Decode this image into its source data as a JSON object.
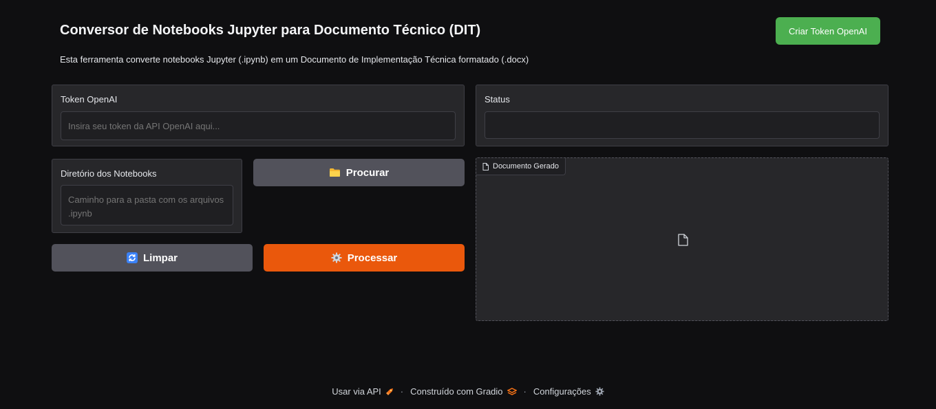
{
  "header": {
    "title": "Conversor de Notebooks Jupyter para Documento Técnico (DIT)",
    "subtitle": "Esta ferramenta converte notebooks Jupyter (.ipynb) em um Documento de Implementação Técnica formatado (.docx)",
    "token_button": "Criar Token OpenAI"
  },
  "token": {
    "label": "Token OpenAI",
    "placeholder": "Insira seu token da API OpenAI aqui...",
    "value": ""
  },
  "directory": {
    "label": "Diretório dos Notebooks",
    "placeholder": "Caminho para a pasta com os arquivos .ipynb",
    "value": ""
  },
  "buttons": {
    "browse": "Procurar",
    "clear": "Limpar",
    "process": "Processar"
  },
  "status": {
    "label": "Status",
    "value": ""
  },
  "document": {
    "label": "Documento Gerado"
  },
  "footer": {
    "api": "Usar via API",
    "built": "Construído com Gradio",
    "settings": "Configurações",
    "separator": "·"
  },
  "colors": {
    "accent_orange": "#ea580c",
    "token_green": "#4caf50",
    "button_gray": "#52525b",
    "background": "#0f0f11"
  },
  "icons": {
    "browse": "folder-icon",
    "clear": "refresh-icon",
    "process": "gear-icon",
    "document": "file-icon",
    "api": "rocket-icon",
    "gradio": "gradio-logo-icon",
    "settings": "gear-icon"
  }
}
